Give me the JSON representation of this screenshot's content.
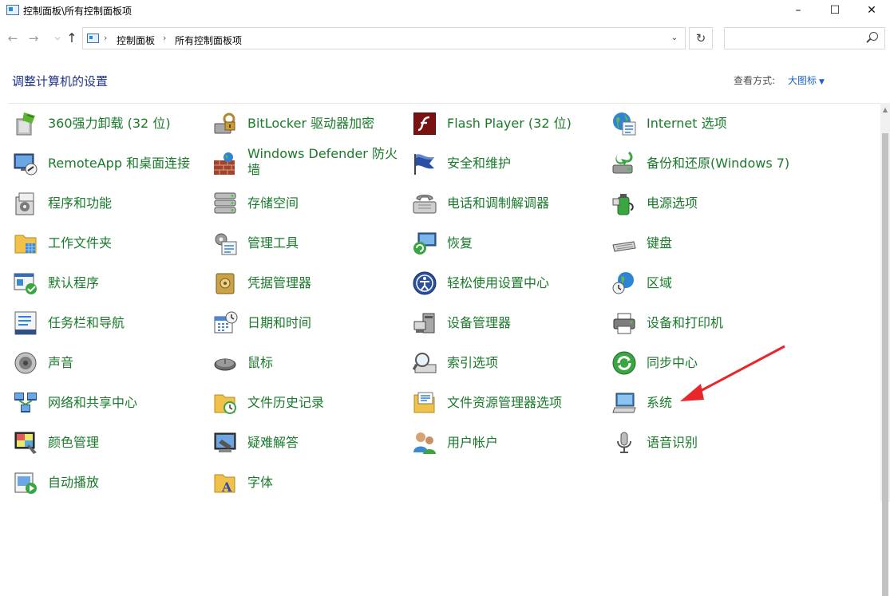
{
  "window": {
    "title": "控制面板\\所有控制面板项",
    "minimize_icon": "minimize-icon",
    "maximize_icon": "maximize-icon",
    "close_icon": "close-icon"
  },
  "address_bar": {
    "crumbs": [
      "控制面板",
      "所有控制面板项"
    ]
  },
  "search": {
    "placeholder": ""
  },
  "header": {
    "title": "调整计算机的设置",
    "view_by_label": "查看方式:",
    "view_by_value": "大图标"
  },
  "items": [
    {
      "label": "360强力卸载 (32 位)",
      "icon": "uninstaller-icon"
    },
    {
      "label": "BitLocker 驱动器加密",
      "icon": "bitlocker-icon"
    },
    {
      "label": "Flash Player (32 位)",
      "icon": "flash-player-icon"
    },
    {
      "label": "Internet 选项",
      "icon": "internet-options-icon"
    },
    {
      "label": "RemoteApp 和桌面连接",
      "icon": "remoteapp-icon"
    },
    {
      "label": "Windows Defender 防火墙",
      "icon": "firewall-icon"
    },
    {
      "label": "安全和维护",
      "icon": "security-flag-icon"
    },
    {
      "label": "备份和还原(Windows 7)",
      "icon": "backup-icon"
    },
    {
      "label": "程序和功能",
      "icon": "programs-icon"
    },
    {
      "label": "存储空间",
      "icon": "storage-icon"
    },
    {
      "label": "电话和调制解调器",
      "icon": "phone-modem-icon"
    },
    {
      "label": "电源选项",
      "icon": "power-icon"
    },
    {
      "label": "工作文件夹",
      "icon": "work-folders-icon"
    },
    {
      "label": "管理工具",
      "icon": "admin-tools-icon"
    },
    {
      "label": "恢复",
      "icon": "recovery-icon"
    },
    {
      "label": "键盘",
      "icon": "keyboard-icon"
    },
    {
      "label": "默认程序",
      "icon": "default-programs-icon"
    },
    {
      "label": "凭据管理器",
      "icon": "credential-manager-icon"
    },
    {
      "label": "轻松使用设置中心",
      "icon": "ease-of-access-icon"
    },
    {
      "label": "区域",
      "icon": "region-icon"
    },
    {
      "label": "任务栏和导航",
      "icon": "taskbar-icon"
    },
    {
      "label": "日期和时间",
      "icon": "date-time-icon"
    },
    {
      "label": "设备管理器",
      "icon": "device-manager-icon"
    },
    {
      "label": "设备和打印机",
      "icon": "printer-icon"
    },
    {
      "label": "声音",
      "icon": "sound-icon"
    },
    {
      "label": "鼠标",
      "icon": "mouse-icon"
    },
    {
      "label": "索引选项",
      "icon": "indexing-icon"
    },
    {
      "label": "同步中心",
      "icon": "sync-center-icon"
    },
    {
      "label": "网络和共享中心",
      "icon": "network-icon"
    },
    {
      "label": "文件历史记录",
      "icon": "file-history-icon"
    },
    {
      "label": "文件资源管理器选项",
      "icon": "explorer-options-icon"
    },
    {
      "label": "系统",
      "icon": "system-icon"
    },
    {
      "label": "颜色管理",
      "icon": "color-management-icon"
    },
    {
      "label": "疑难解答",
      "icon": "troubleshooting-icon"
    },
    {
      "label": "用户帐户",
      "icon": "user-accounts-icon"
    },
    {
      "label": "语音识别",
      "icon": "speech-recognition-icon"
    },
    {
      "label": "自动播放",
      "icon": "autoplay-icon"
    },
    {
      "label": "字体",
      "icon": "fonts-icon"
    }
  ],
  "colors": {
    "item_text": "#197a2a",
    "heading": "#1e3287",
    "link": "#1a62c5",
    "annotation_arrow": "#e8262b"
  }
}
